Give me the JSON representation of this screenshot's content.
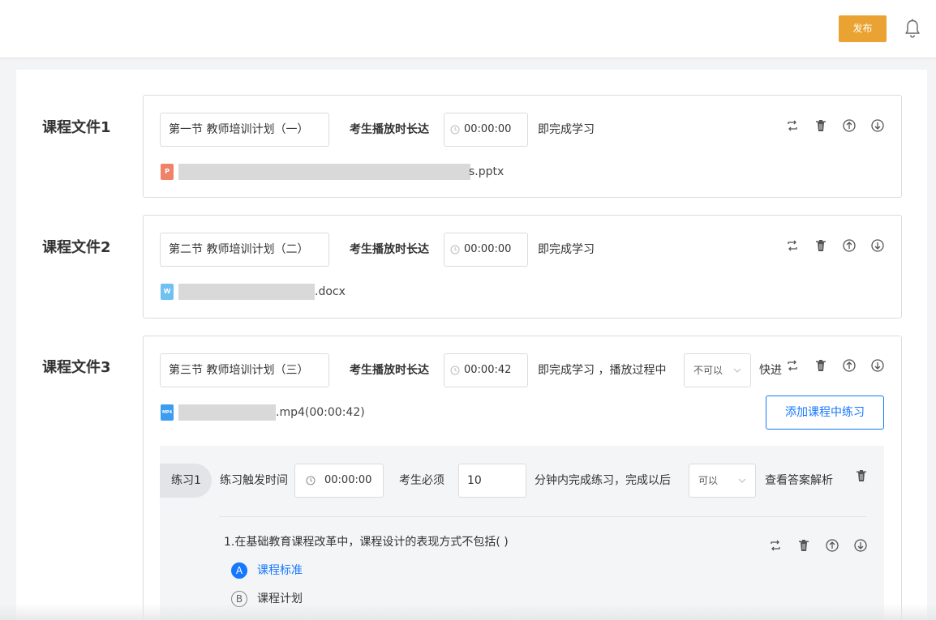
{
  "header": {
    "publish_label": "发布",
    "bell_icon": "bell-icon"
  },
  "files": [
    {
      "label": "课程文件1",
      "title": "第一节 教师培训计划（一）",
      "play_label": "考生播放时长达",
      "time": "00:00:00",
      "complete_label": "即完成学习",
      "file_icon": "ppt-file-icon",
      "file_icon_text": "P",
      "file_icon_color": "#f0826a",
      "file_suffix": "s.pptx"
    },
    {
      "label": "课程文件2",
      "title": "第二节 教师培训计划（二）",
      "play_label": "考生播放时长达",
      "time": "00:00:00",
      "complete_label": "即完成学习",
      "file_icon": "word-file-icon",
      "file_icon_text": "W",
      "file_icon_color": "#6ec1f0",
      "file_suffix": ".docx"
    },
    {
      "label": "课程文件3",
      "title": "第三节 教师培训计划（三）",
      "play_label": "考生播放时长达",
      "time": "00:00:42",
      "complete_label": "即完成学习 ，播放过程中",
      "fast_forward_select": "不可以",
      "fast_forward_label": "快进",
      "file_icon": "mp4-file-icon",
      "file_icon_text": "MP4",
      "file_icon_color": "#3b9cf0",
      "file_suffix": ".mp4(00:00:42)",
      "add_practice_label": "添加课程中练习"
    }
  ],
  "practice": {
    "tag": "练习1",
    "trigger_label": "练习触发时间",
    "trigger_time": "00:00:00",
    "must_label": "考生必须",
    "minutes": "10",
    "minutes_label": "分钟内完成练习，完成以后",
    "view_select": "可以",
    "view_label": "查看答案解析",
    "question": "1.在基础教育课程改革中，课程设计的表现方式不包括( )",
    "options": [
      {
        "letter": "A",
        "text": "课程标准",
        "selected": true
      },
      {
        "letter": "B",
        "text": "课程计划",
        "selected": false
      }
    ]
  },
  "colors": {
    "accent": "#1677ff",
    "publish": "#eaa332"
  }
}
